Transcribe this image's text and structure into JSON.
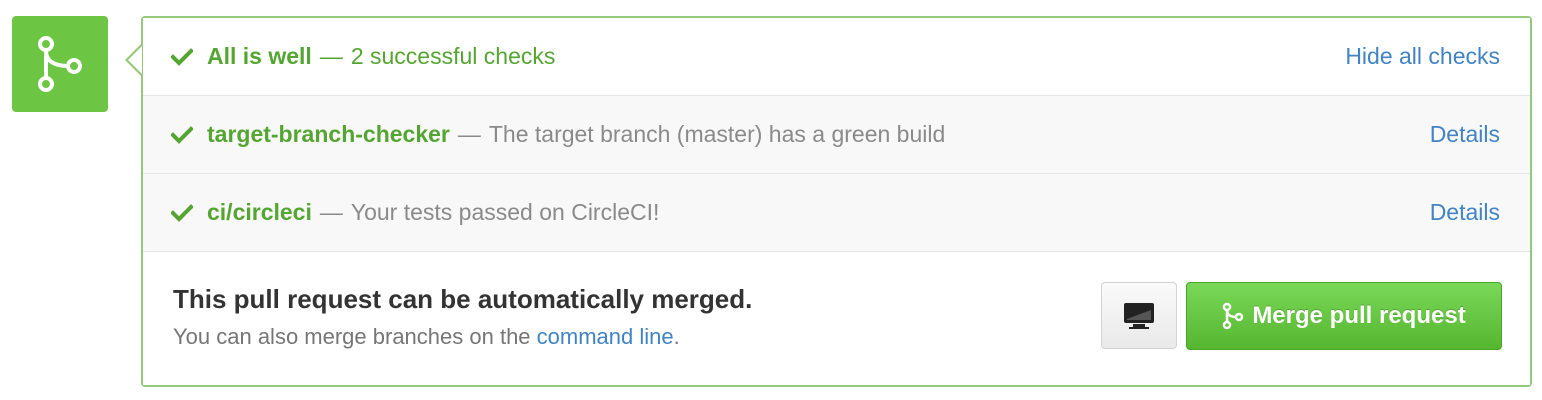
{
  "colors": {
    "success_green": "#55a532",
    "tile_green": "#6cc644",
    "link_blue": "#4183c4",
    "box_border": "#95c97a"
  },
  "status_icon": "git-merge-icon",
  "summary": {
    "title": "All is well",
    "separator": "—",
    "detail": "2 successful checks",
    "toggle_label": "Hide all checks"
  },
  "checks": [
    {
      "name": "target-branch-checker",
      "separator": "—",
      "description": "The target branch (master) has a green build",
      "link_label": "Details",
      "icon": "check-icon"
    },
    {
      "name": "ci/circleci",
      "separator": "—",
      "description": "Your tests passed on CircleCI!",
      "link_label": "Details",
      "icon": "check-icon"
    }
  ],
  "merge": {
    "title": "This pull request can be automatically merged.",
    "sub_prefix": "You can also merge branches on the ",
    "sub_link": "command line",
    "sub_suffix": ".",
    "cli_icon": "desktop-icon",
    "button_label": "Merge pull request",
    "button_icon": "git-merge-icon"
  }
}
